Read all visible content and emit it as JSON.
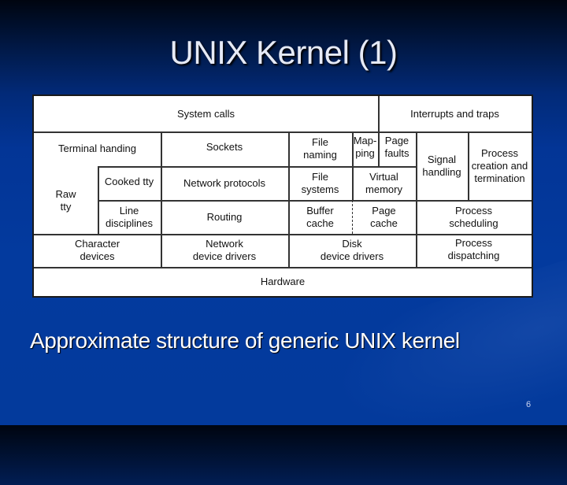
{
  "slide": {
    "title": "UNIX Kernel (1)",
    "caption": "Approximate structure of generic UNIX kernel",
    "page_number": "6"
  },
  "diagram": {
    "cells": {
      "system_calls": "System calls",
      "interrupts_and_traps": "Interrupts and traps",
      "terminal_handling": "Terminal handing",
      "sockets": "Sockets",
      "file_naming": "File\nnaming",
      "mapping": "Map-\nping",
      "page_faults": "Page\nfaults",
      "signal_handling": "Signal\nhandling",
      "process_creation": "Process\ncreation and\ntermination",
      "raw_tty": "Raw\ntty",
      "cooked_tty": "Cooked tty",
      "network_protocols": "Network protocols",
      "file_systems": "File\nsystems",
      "virtual_memory": "Virtual\nmemory",
      "line_disciplines": "Line\ndisciplines",
      "routing": "Routing",
      "buffer_cache": "Buffer\ncache",
      "page_cache": "Page\ncache",
      "process_scheduling": "Process\nscheduling",
      "character_devices": "Character\ndevices",
      "network_device_drivers": "Network\ndevice drivers",
      "disk_device_drivers": "Disk\ndevice drivers",
      "process_dispatching": "Process\ndispatching",
      "hardware": "Hardware"
    }
  }
}
